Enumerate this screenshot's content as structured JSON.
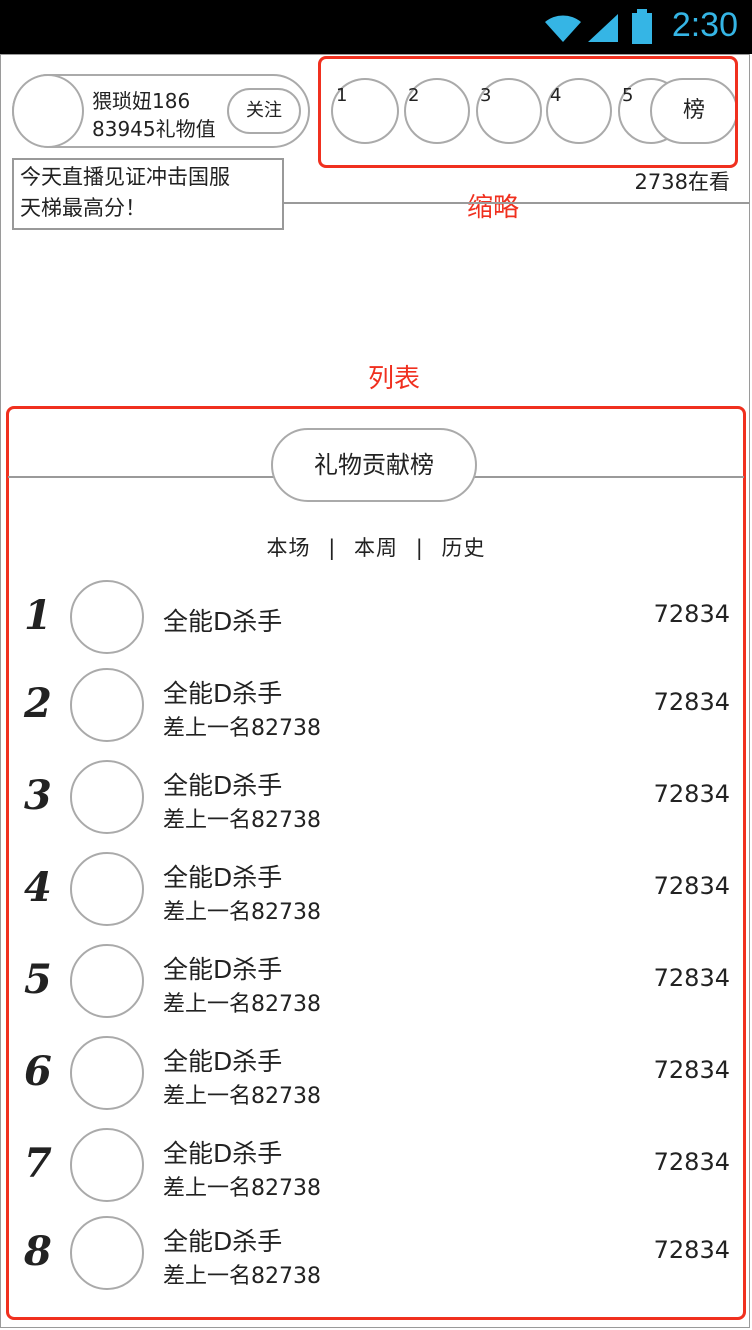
{
  "statusbar": {
    "time": "2:30",
    "accent_color": "#35b5e5"
  },
  "anchor": {
    "name": "猥琐妞186",
    "gift_value": "83945礼物值",
    "follow_label": "关注"
  },
  "top_ranks": {
    "numbers": [
      "1",
      "2",
      "3",
      "4",
      "5"
    ],
    "rank_button_label": "榜"
  },
  "live": {
    "description_line1": "今天直播见证冲击国服",
    "description_line2": "天梯最高分！",
    "watching": "2738在看"
  },
  "annotations": {
    "thumbnail_note": "缩略",
    "list_note": "列表",
    "color": "#f0301f"
  },
  "gift_board": {
    "title": "礼物贡献榜",
    "periods": [
      "本场",
      "本周",
      "历史"
    ],
    "separator": "|",
    "rows": [
      {
        "rank": "1",
        "name": "全能D杀手",
        "gap": "",
        "score": "72834"
      },
      {
        "rank": "2",
        "name": "全能D杀手",
        "gap": "差上一名82738",
        "score": "72834"
      },
      {
        "rank": "3",
        "name": "全能D杀手",
        "gap": "差上一名82738",
        "score": "72834"
      },
      {
        "rank": "4",
        "name": "全能D杀手",
        "gap": "差上一名82738",
        "score": "72834"
      },
      {
        "rank": "5",
        "name": "全能D杀手",
        "gap": "差上一名82738",
        "score": "72834"
      },
      {
        "rank": "6",
        "name": "全能D杀手",
        "gap": "差上一名82738",
        "score": "72834"
      },
      {
        "rank": "7",
        "name": "全能D杀手",
        "gap": "差上一名82738",
        "score": "72834"
      },
      {
        "rank": "8",
        "name": "全能D杀手",
        "gap": "差上一名82738",
        "score": "72834"
      }
    ]
  }
}
